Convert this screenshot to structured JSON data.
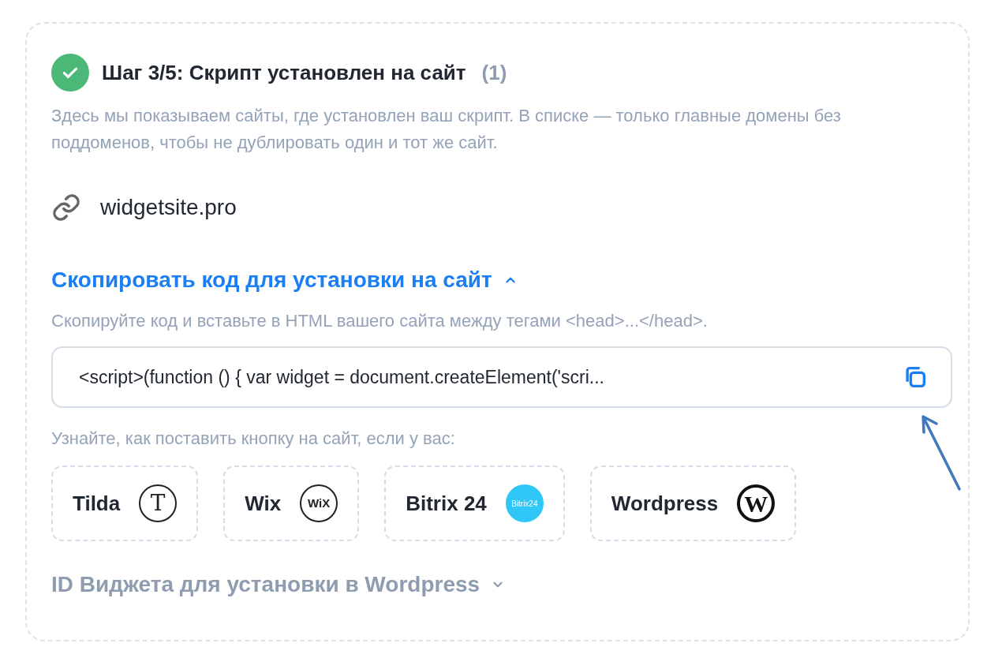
{
  "step": {
    "title": "Шаг 3/5: Скрипт установлен на сайт",
    "count": "(1)",
    "completed": true,
    "description": "Здесь мы показываем сайты, где установлен ваш скрипт. В списке — только главные домены без поддоменов, чтобы не дублировать один и тот же сайт."
  },
  "sites": [
    {
      "domain": "widgetsite.pro"
    }
  ],
  "copy_section": {
    "title": "Скопировать код для установки на сайт",
    "expanded": true,
    "hint": "Скопируйте код и вставьте в HTML вашего сайта между тегами <head>...</head>.",
    "code": "<script>(function () { var widget = document.createElement('scri...",
    "platforms_hint": "Узнайте, как поставить кнопку на сайт, если у вас:",
    "platforms": [
      {
        "name": "Tilda",
        "kind": "tilda",
        "logo_text": "T"
      },
      {
        "name": "Wix",
        "kind": "wix",
        "logo_text": "WiX"
      },
      {
        "name": "Bitrix 24",
        "kind": "bitrix",
        "logo_text": "Bitrix24"
      },
      {
        "name": "Wordpress",
        "kind": "wordpress",
        "logo_text": "W"
      }
    ]
  },
  "id_section": {
    "title": "ID Виджета для установки в Wordpress",
    "expanded": false
  }
}
